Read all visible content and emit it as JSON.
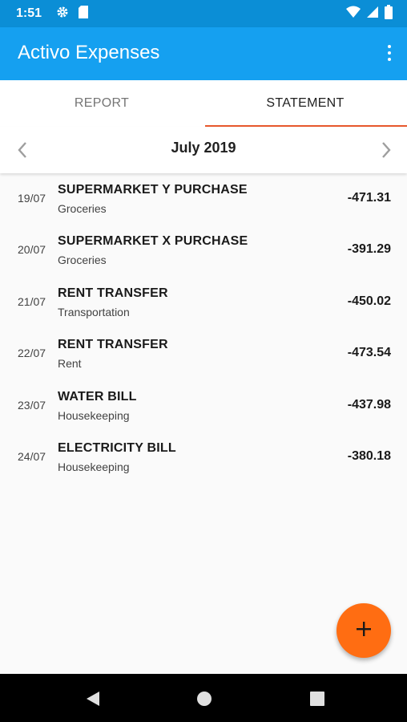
{
  "status_bar": {
    "time": "1:51",
    "icons": [
      "gear-icon",
      "sd-card-icon",
      "wifi-icon",
      "signal-icon",
      "battery-icon"
    ]
  },
  "app_bar": {
    "title": "Activo Expenses",
    "menu_icon": "overflow-menu-icon"
  },
  "tabs": [
    {
      "label": "REPORT",
      "active": false
    },
    {
      "label": "STATEMENT",
      "active": true
    }
  ],
  "month_nav": {
    "label": "July 2019",
    "prev_icon": "chevron-left-icon",
    "next_icon": "chevron-right-icon"
  },
  "transactions": [
    {
      "date": "19/07",
      "title": "SUPERMARKET Y PURCHASE",
      "category": "Groceries",
      "amount": "-471.31"
    },
    {
      "date": "20/07",
      "title": "SUPERMARKET X PURCHASE",
      "category": "Groceries",
      "amount": "-391.29"
    },
    {
      "date": "21/07",
      "title": "RENT TRANSFER",
      "category": "Transportation",
      "amount": "-450.02"
    },
    {
      "date": "22/07",
      "title": "RENT TRANSFER",
      "category": "Rent",
      "amount": "-473.54"
    },
    {
      "date": "23/07",
      "title": "WATER BILL",
      "category": "Housekeeping",
      "amount": "-437.98"
    },
    {
      "date": "24/07",
      "title": "ELECTRICITY BILL",
      "category": "Housekeeping",
      "amount": "-380.18"
    }
  ],
  "fab": {
    "icon": "plus-icon"
  },
  "nav_bar": {
    "icons": [
      "back-icon",
      "home-icon",
      "recents-icon"
    ]
  },
  "colors": {
    "status_bar": "#0b8ed6",
    "app_bar": "#15a0f0",
    "tab_indicator": "#e8582d",
    "fab": "#ff6d12"
  }
}
